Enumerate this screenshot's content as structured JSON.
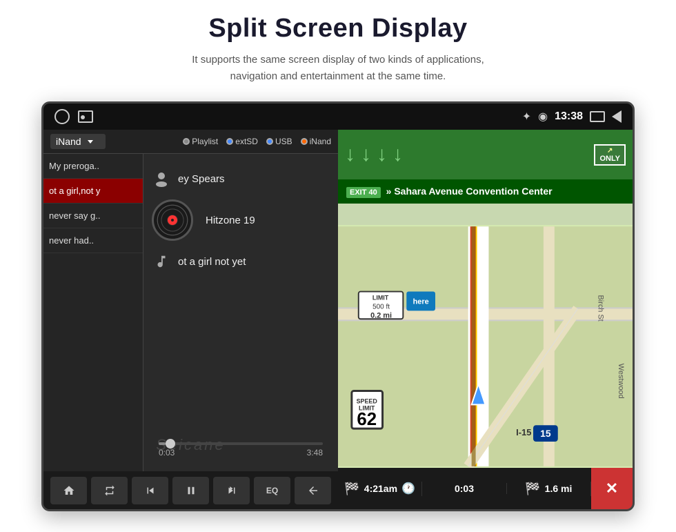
{
  "page": {
    "title": "Split Screen Display",
    "subtitle_line1": "It supports the same screen display of two kinds of applications,",
    "subtitle_line2": "navigation and entertainment at the same time."
  },
  "status_bar": {
    "time": "13:38",
    "bluetooth_icon": "bluetooth",
    "location_icon": "location-pin"
  },
  "music_player": {
    "source_dropdown": "iNand",
    "sources": [
      {
        "label": "Playlist",
        "active": false
      },
      {
        "label": "extSD",
        "active": false
      },
      {
        "label": "USB",
        "active": false
      },
      {
        "label": "iNand",
        "active": true
      }
    ],
    "song_list": [
      {
        "title": "My preroga..",
        "active": false
      },
      {
        "title": "ot a girl,not y",
        "active": true
      },
      {
        "title": "never say g..",
        "active": false
      },
      {
        "title": "never had..",
        "active": false
      }
    ],
    "current_artist": "ey Spears",
    "current_album": "Hitzone 19",
    "current_title": "ot a girl not yet",
    "time_current": "0:03",
    "time_total": "3:48",
    "progress_percent": 4,
    "watermark": "Seicane",
    "controls": {
      "home": "⌂",
      "repeat": "↺",
      "prev": "⏮",
      "play_pause": "⏸",
      "next": "⏭",
      "eq": "EQ",
      "back": "↩"
    }
  },
  "navigation": {
    "street_sign_top": "Sahara Avenue",
    "exit_badge": "EXIT 40",
    "direction_text": "» Sahara Avenue Convention Center",
    "distance_small": "0.2 mi",
    "distance_ft": "500 ft",
    "speed_limit": "62",
    "highway": "I-15",
    "highway_number": "15",
    "only_label": "ONLY",
    "eta_time": "4:21am",
    "travel_time": "0:03",
    "distance_remaining": "1.6 mi"
  }
}
